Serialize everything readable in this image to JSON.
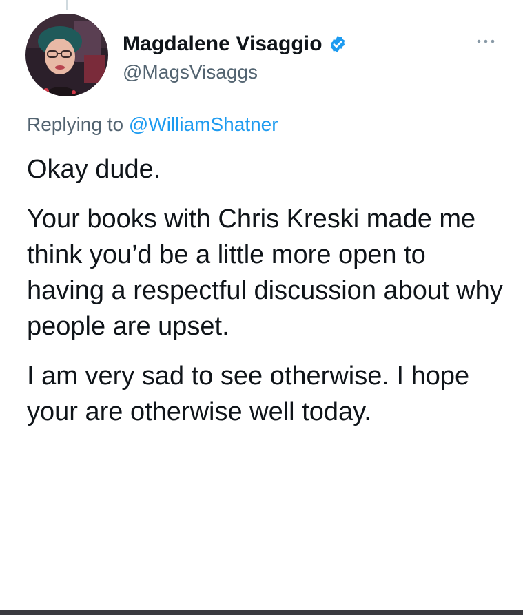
{
  "tweet": {
    "author": {
      "display_name": "Magdalene Visaggio",
      "handle": "@MagsVisaggs",
      "verified": true,
      "avatar_icon": "profile-photo"
    },
    "more_icon": "more-options-icon",
    "replying": {
      "prefix": "Replying to",
      "mention": "@WilliamShatner"
    },
    "paragraphs": [
      "Okay dude.",
      "Your books with Chris Kreski made me think you’d be a little more open to having a respectful discussion about why people are upset.",
      "I am very sad to see otherwise. I hope your are otherwise well today."
    ]
  },
  "colors": {
    "primary_text": "#0f1419",
    "secondary_text": "#536471",
    "accent": "#1d9bf0"
  }
}
